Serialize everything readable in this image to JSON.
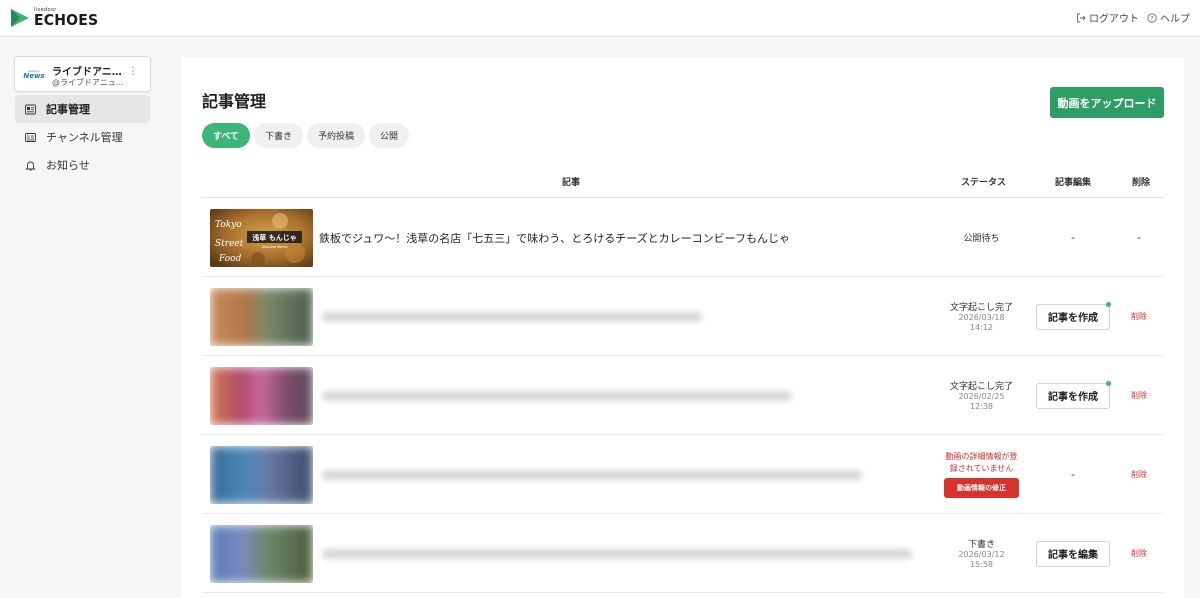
{
  "app": {
    "logo_sub": "livedoor",
    "logo_main": "ECHOES",
    "brand_color": "#2e9e64"
  },
  "header": {
    "logout_label": "ログアウト",
    "help_label": "ヘルプ"
  },
  "sidebar": {
    "channel": {
      "logo_top": "livedoor",
      "logo_news": "News",
      "name": "ライブドアニ…",
      "handle": "@ライブドアニュ…"
    },
    "items": [
      {
        "label": "記事管理",
        "icon": "article-icon",
        "active": true
      },
      {
        "label": "チャンネル管理",
        "icon": "channel-icon",
        "active": false
      },
      {
        "label": "お知らせ",
        "icon": "bell-icon",
        "active": false
      }
    ]
  },
  "main": {
    "title": "記事管理",
    "upload_label": "動画をアップロード",
    "tabs": [
      {
        "label": "すべて",
        "active": true
      },
      {
        "label": "下書き",
        "active": false
      },
      {
        "label": "予約投稿",
        "active": false
      },
      {
        "label": "公開",
        "active": false
      }
    ],
    "columns": {
      "article": "記事",
      "status": "ステータス",
      "edit": "記事編集",
      "delete": "削除"
    },
    "rows": [
      {
        "title": "鉄板でジュワ〜！浅草の名店「七五三」で味わう、とろけるチーズとカレーコンビーフもんじゃ",
        "thumb_text_1": "Tokyo",
        "thumb_text_2": "Street",
        "thumb_text_3": "Food",
        "thumb_banner": "浅草 もんじゃ",
        "thumb_banner_sub": "Asakusa Monja",
        "status": "公開待ち",
        "edit": "-",
        "delete": "-"
      },
      {
        "status": "文字起こし完了",
        "date": "2026/03/18",
        "time": "14:12",
        "edit_label": "記事を作成",
        "delete_label": "削除"
      },
      {
        "status": "文字起こし完了",
        "date": "2026/02/25",
        "time": "12:38",
        "edit_label": "記事を作成",
        "delete_label": "削除"
      },
      {
        "error_line1": "動画の詳細情報が登",
        "error_line2": "録されていません",
        "fix_label": "動画情報の修正",
        "edit": "-",
        "delete_label": "削除"
      },
      {
        "status": "下書き",
        "date": "2026/03/12",
        "time": "15:58",
        "edit_label": "記事を編集",
        "delete_label": "削除"
      }
    ]
  }
}
